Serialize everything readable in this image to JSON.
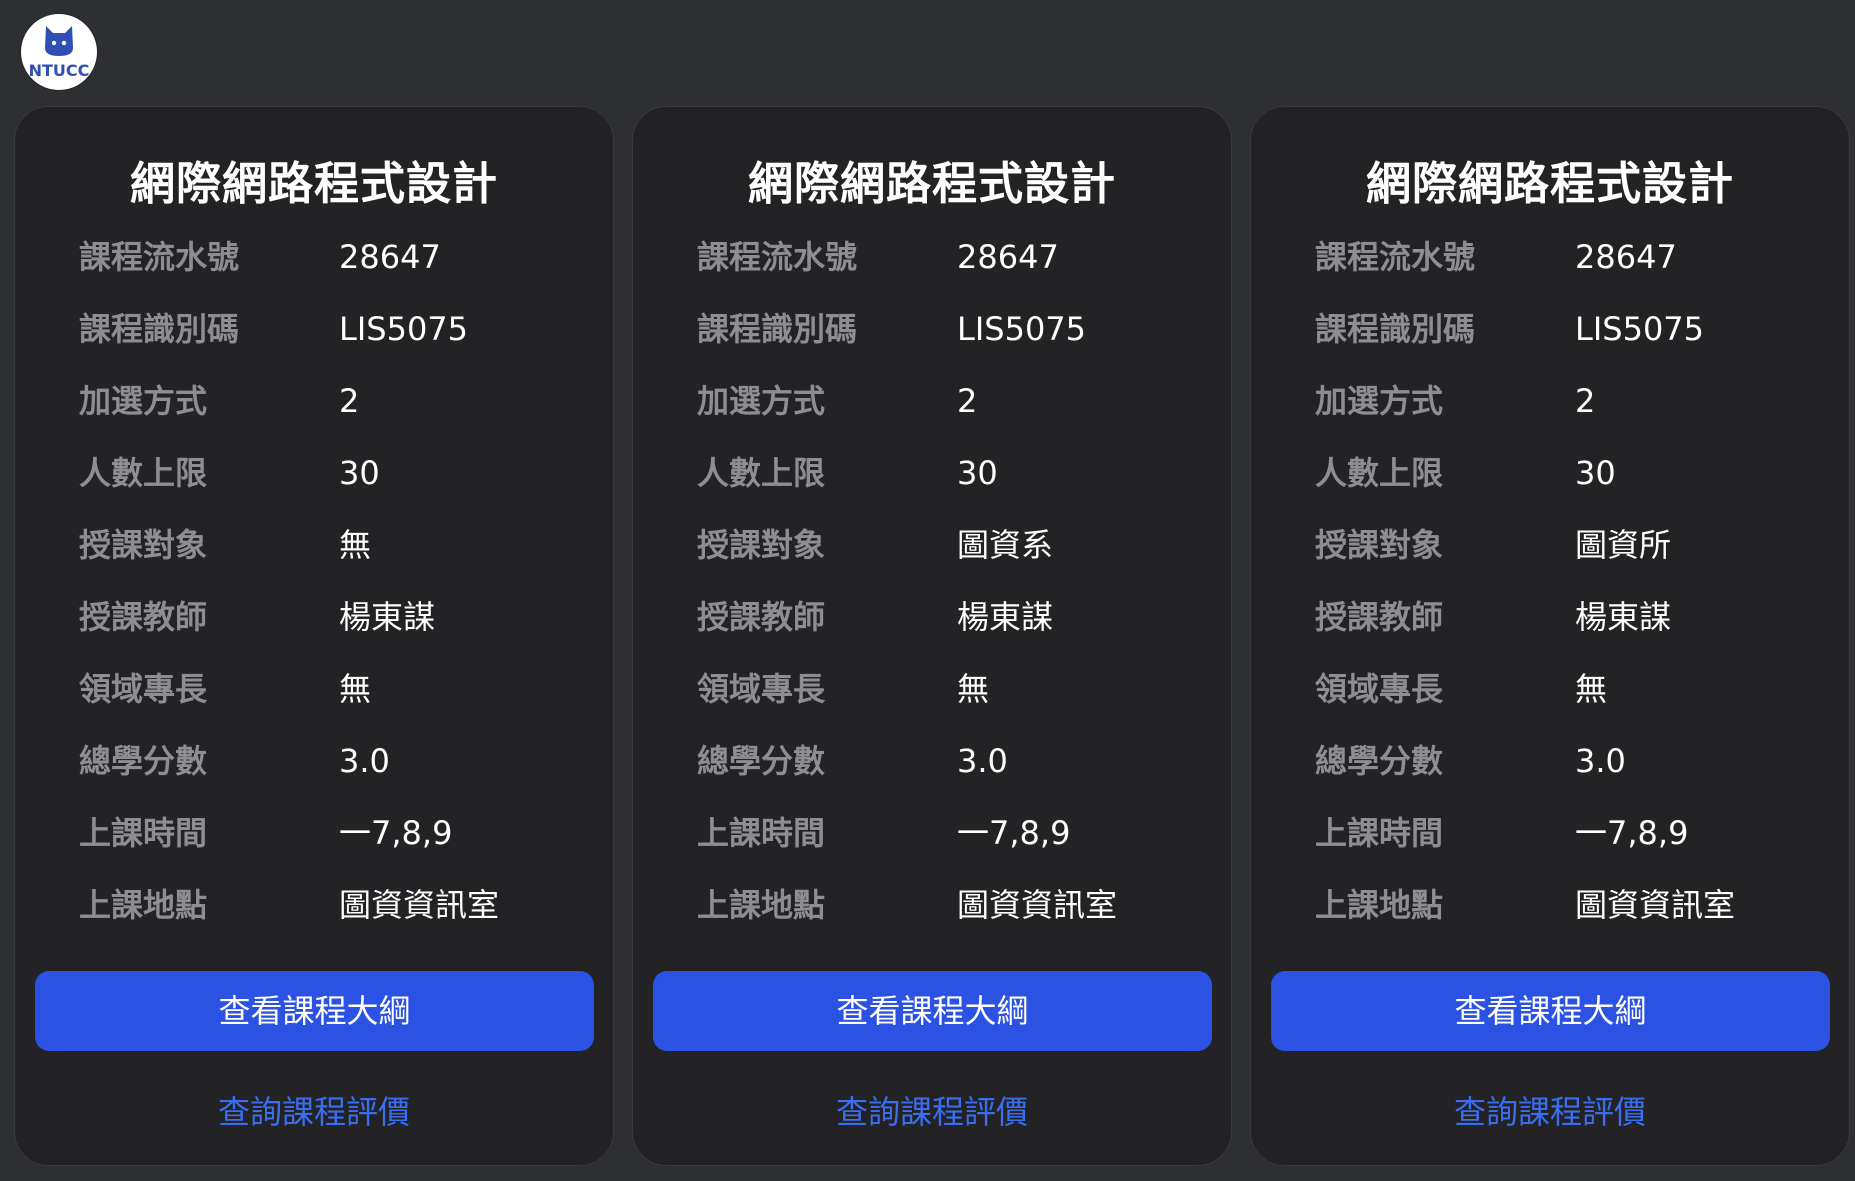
{
  "logo": {
    "text": "NTUCC",
    "brand_color": "#2f4fb5"
  },
  "colors": {
    "background": "#2e2f32",
    "card": "#232326",
    "label": "#8d8e93",
    "value": "#ffffff",
    "button": "#2b52e2",
    "link": "#3a6df0"
  },
  "cards": [
    {
      "title": "網際網路程式設計",
      "fields": [
        {
          "label": "課程流水號",
          "value": "28647"
        },
        {
          "label": "課程識別碼",
          "value": "LIS5075"
        },
        {
          "label": "加選方式",
          "value": "2"
        },
        {
          "label": "人數上限",
          "value": "30"
        },
        {
          "label": "授課對象",
          "value": "無"
        },
        {
          "label": "授課教師",
          "value": "楊東謀"
        },
        {
          "label": "領域專長",
          "value": "無"
        },
        {
          "label": "總學分數",
          "value": "3.0"
        },
        {
          "label": "上課時間",
          "value": "一7,8,9"
        },
        {
          "label": "上課地點",
          "value": "圖資資訊室"
        }
      ],
      "primary_button": "查看課程大綱",
      "link_button": "查詢課程評價"
    },
    {
      "title": "網際網路程式設計",
      "fields": [
        {
          "label": "課程流水號",
          "value": "28647"
        },
        {
          "label": "課程識別碼",
          "value": "LIS5075"
        },
        {
          "label": "加選方式",
          "value": "2"
        },
        {
          "label": "人數上限",
          "value": "30"
        },
        {
          "label": "授課對象",
          "value": "圖資系"
        },
        {
          "label": "授課教師",
          "value": "楊東謀"
        },
        {
          "label": "領域專長",
          "value": "無"
        },
        {
          "label": "總學分數",
          "value": "3.0"
        },
        {
          "label": "上課時間",
          "value": "一7,8,9"
        },
        {
          "label": "上課地點",
          "value": "圖資資訊室"
        }
      ],
      "primary_button": "查看課程大綱",
      "link_button": "查詢課程評價"
    },
    {
      "title": "網際網路程式設計",
      "fields": [
        {
          "label": "課程流水號",
          "value": "28647"
        },
        {
          "label": "課程識別碼",
          "value": "LIS5075"
        },
        {
          "label": "加選方式",
          "value": "2"
        },
        {
          "label": "人數上限",
          "value": "30"
        },
        {
          "label": "授課對象",
          "value": "圖資所"
        },
        {
          "label": "授課教師",
          "value": "楊東謀"
        },
        {
          "label": "領域專長",
          "value": "無"
        },
        {
          "label": "總學分數",
          "value": "3.0"
        },
        {
          "label": "上課時間",
          "value": "一7,8,9"
        },
        {
          "label": "上課地點",
          "value": "圖資資訊室"
        }
      ],
      "primary_button": "查看課程大綱",
      "link_button": "查詢課程評價"
    }
  ]
}
